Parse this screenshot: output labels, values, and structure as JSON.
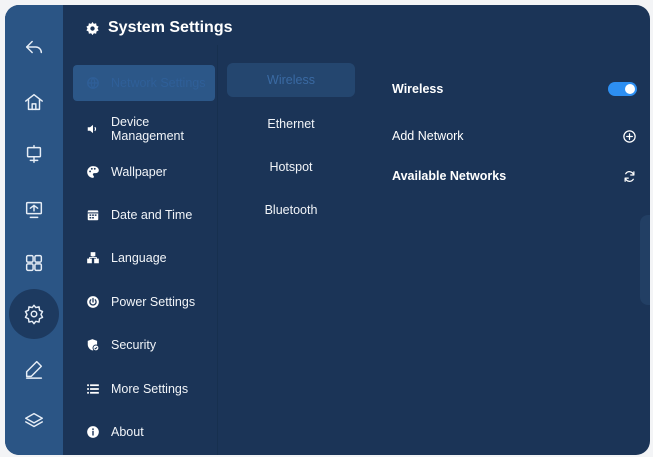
{
  "header": {
    "title": "System Settings",
    "icon": "gear-icon"
  },
  "rail": {
    "items": [
      {
        "name": "back",
        "icon": "back-arrow-icon"
      },
      {
        "name": "home",
        "icon": "home-icon"
      },
      {
        "name": "whiteboard",
        "icon": "easel-icon"
      },
      {
        "name": "screen",
        "icon": "screen-cast-icon"
      },
      {
        "name": "apps",
        "icon": "apps-grid-icon"
      },
      {
        "name": "settings",
        "icon": "gear-icon",
        "active": true
      },
      {
        "name": "annotate",
        "icon": "pen-icon"
      },
      {
        "name": "layers",
        "icon": "layers-icon"
      }
    ]
  },
  "menu": {
    "items": [
      {
        "label": "Network Settings",
        "icon": "globe-icon",
        "active": true
      },
      {
        "label": "Device\nManagement",
        "icon": "speaker-icon"
      },
      {
        "label": "Wallpaper",
        "icon": "palette-icon"
      },
      {
        "label": "Date and Time",
        "icon": "calendar-icon"
      },
      {
        "label": "Language",
        "icon": "language-icon"
      },
      {
        "label": "Power Settings",
        "icon": "power-icon"
      },
      {
        "label": "Security",
        "icon": "shield-icon"
      },
      {
        "label": "More Settings",
        "icon": "list-icon"
      },
      {
        "label": "About",
        "icon": "info-icon"
      }
    ]
  },
  "tabs": {
    "items": [
      {
        "label": "Wireless",
        "active": true
      },
      {
        "label": "Ethernet"
      },
      {
        "label": "Hotspot"
      },
      {
        "label": "Bluetooth"
      }
    ]
  },
  "settings": {
    "wireless_label": "Wireless",
    "wireless_on": true,
    "add_network_label": "Add Network",
    "available_networks_label": "Available Networks"
  },
  "colors": {
    "background": "#1b3457",
    "rail": "#2b5585",
    "active_item": "#2c5788",
    "toggle_on": "#2d8ff2"
  }
}
